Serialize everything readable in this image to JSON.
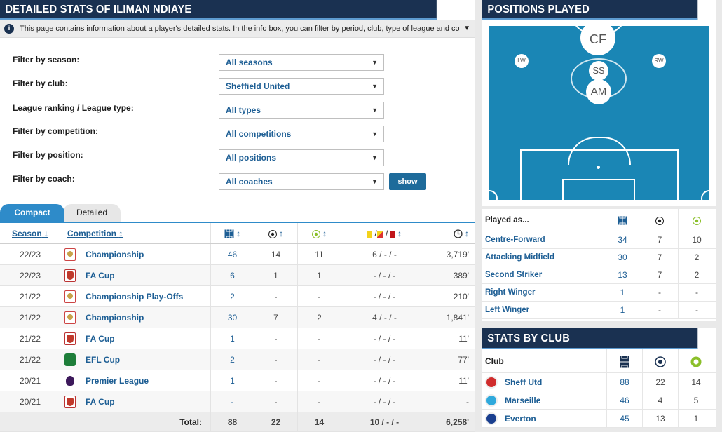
{
  "left": {
    "title": "DETAILED STATS OF ILIMAN NDIAYE",
    "info": "This page contains information about a player's detailed stats. In the info box, you can filter by period, club, type of league and competition. Th...",
    "filters": [
      {
        "label": "Filter by season:",
        "value": "All seasons"
      },
      {
        "label": "Filter by club:",
        "value": "Sheffield United"
      },
      {
        "label": "League ranking / League type:",
        "value": "All types"
      },
      {
        "label": "Filter by competition:",
        "value": "All competitions"
      },
      {
        "label": "Filter by position:",
        "value": "All positions"
      },
      {
        "label": "Filter by coach:",
        "value": "All coaches"
      }
    ],
    "show_label": "show",
    "tabs": [
      "Compact",
      "Detailed"
    ],
    "table": {
      "headers": {
        "season": "Season",
        "competition": "Competition"
      },
      "rows": [
        {
          "season": "22/23",
          "competition": "Championship",
          "logo": "championship",
          "apps": "46",
          "goals": "14",
          "assists": "11",
          "cards": "6 / - / -",
          "minutes": "3,719'"
        },
        {
          "season": "22/23",
          "competition": "FA Cup",
          "logo": "fa-cup",
          "apps": "6",
          "goals": "1",
          "assists": "1",
          "cards": "- / - / -",
          "minutes": "389'"
        },
        {
          "season": "21/22",
          "competition": "Championship Play-Offs",
          "logo": "championship",
          "apps": "2",
          "goals": "-",
          "assists": "-",
          "cards": "- / - / -",
          "minutes": "210'"
        },
        {
          "season": "21/22",
          "competition": "Championship",
          "logo": "championship",
          "apps": "30",
          "goals": "7",
          "assists": "2",
          "cards": "4 / - / -",
          "minutes": "1,841'"
        },
        {
          "season": "21/22",
          "competition": "FA Cup",
          "logo": "fa-cup",
          "apps": "1",
          "goals": "-",
          "assists": "-",
          "cards": "- / - / -",
          "minutes": "11'"
        },
        {
          "season": "21/22",
          "competition": "EFL Cup",
          "logo": "efl-cup",
          "apps": "2",
          "goals": "-",
          "assists": "-",
          "cards": "- / - / -",
          "minutes": "77'"
        },
        {
          "season": "20/21",
          "competition": "Premier League",
          "logo": "premier-league",
          "apps": "1",
          "goals": "-",
          "assists": "-",
          "cards": "- / - / -",
          "minutes": "11'"
        },
        {
          "season": "20/21",
          "competition": "FA Cup",
          "logo": "fa-cup",
          "apps": "-",
          "goals": "-",
          "assists": "-",
          "cards": "- / - / -",
          "minutes": "-"
        }
      ],
      "total": {
        "label": "Total:",
        "apps": "88",
        "goals": "22",
        "assists": "14",
        "cards": "10 / - / -",
        "minutes": "6,258'"
      }
    }
  },
  "positions": {
    "title": "POSITIONS PLAYED",
    "pitch_labels": {
      "cf": "CF",
      "lw": "LW",
      "rw": "RW",
      "ss": "SS",
      "am": "AM"
    },
    "played_header": "Played as...",
    "rows": [
      {
        "name": "Centre-Forward",
        "apps": "34",
        "goals": "7",
        "assists": "10"
      },
      {
        "name": "Attacking Midfield",
        "apps": "30",
        "goals": "7",
        "assists": "2"
      },
      {
        "name": "Second Striker",
        "apps": "13",
        "goals": "7",
        "assists": "2"
      },
      {
        "name": "Right Winger",
        "apps": "1",
        "goals": "-",
        "assists": "-"
      },
      {
        "name": "Left Winger",
        "apps": "1",
        "goals": "-",
        "assists": "-"
      }
    ]
  },
  "clubs": {
    "title": "STATS BY CLUB",
    "header": "Club",
    "rows": [
      {
        "name": "Sheff Utd",
        "crest_color": "#d02c2c",
        "apps": "88",
        "goals": "22",
        "assists": "14"
      },
      {
        "name": "Marseille",
        "crest_color": "#2fa9dc",
        "apps": "46",
        "goals": "4",
        "assists": "5"
      },
      {
        "name": "Everton",
        "crest_color": "#1a3f8f",
        "apps": "45",
        "goals": "13",
        "assists": "1"
      }
    ]
  },
  "colors": {
    "navy": "#1a3151",
    "accent": "#2e8bc9",
    "link": "#1d5e94",
    "pitch": "#1a86b5"
  }
}
